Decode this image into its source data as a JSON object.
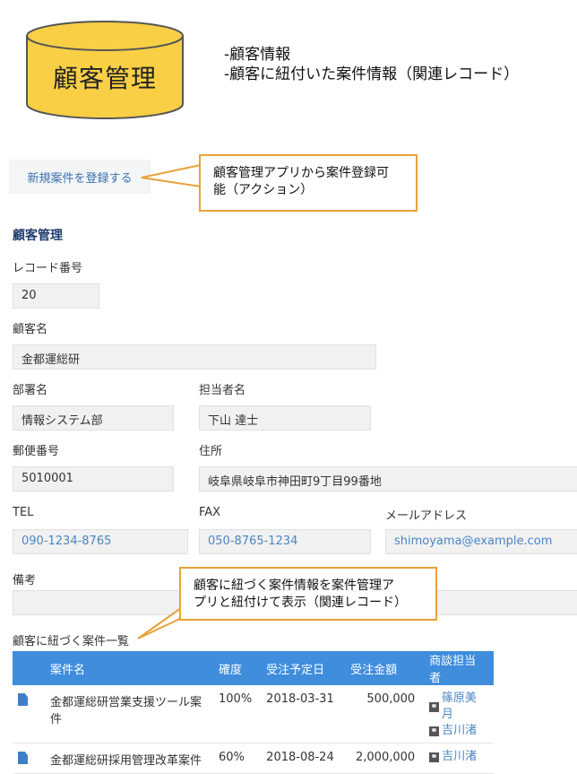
{
  "diagram": {
    "db_label": "顧客管理",
    "desc_lines": [
      "-顧客情報",
      "-顧客に紐付いた案件情報（関連レコード）"
    ]
  },
  "actions": {
    "new_case_button": "新規案件を登録する",
    "callout_top": [
      "顧客管理アプリから案件登録可",
      "能（アクション）"
    ],
    "callout_related": [
      "顧客に紐づく案件情報を案件管理ア",
      "プリと紐付けて表示（関連レコード）"
    ]
  },
  "form": {
    "title": "顧客管理",
    "record_no": {
      "label": "レコード番号",
      "value": "20"
    },
    "customer_name": {
      "label": "顧客名",
      "value": "金都運総研"
    },
    "department": {
      "label": "部署名",
      "value": "情報システム部"
    },
    "person": {
      "label": "担当者名",
      "value": "下山 達士"
    },
    "postal": {
      "label": "郵便番号",
      "value": "5010001"
    },
    "address": {
      "label": "住所",
      "value": "岐阜県岐阜市神田町9丁目99番地"
    },
    "tel": {
      "label": "TEL",
      "value": "090-1234-8765"
    },
    "fax": {
      "label": "FAX",
      "value": "050-8765-1234"
    },
    "email": {
      "label": "メールアドレス",
      "value": "shimoyama@example.com"
    },
    "note": {
      "label": "備考",
      "value": ""
    }
  },
  "related": {
    "title": "顧客に紐づく案件一覧",
    "columns": [
      "案件名",
      "確度",
      "受注予定日",
      "受注金額",
      "商談担当者"
    ],
    "rows": [
      {
        "name": "金都運総研営業支援ツール案件",
        "prob": "100%",
        "date": "2018-03-31",
        "amount": "500,000",
        "staff": [
          "篠原美月",
          "吉川渚"
        ]
      },
      {
        "name": "金都運総研採用管理改革案件",
        "prob": "60%",
        "date": "2018-08-24",
        "amount": "2,000,000",
        "staff": [
          "吉川渚"
        ]
      }
    ]
  },
  "colors": {
    "accent": "#3f8ddc",
    "callout_border": "#e8a13a",
    "cylinder": "#f8cf45"
  }
}
